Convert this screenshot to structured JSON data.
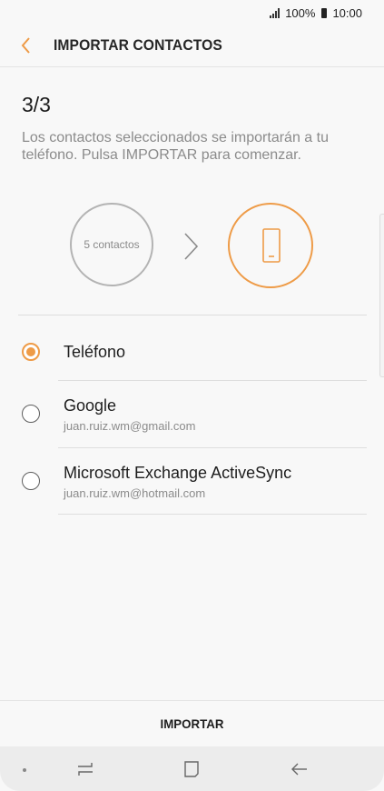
{
  "status_bar": {
    "battery": "100%",
    "time": "10:00"
  },
  "header": {
    "title": "IMPORTAR CONTACTOS"
  },
  "step": "3/3",
  "description": "Los contactos seleccionados se importarán a tu teléfono. Pulsa IMPORTAR para comenzar.",
  "source_circle": {
    "label": "5 contactos"
  },
  "options": [
    {
      "label": "Teléfono",
      "sub": "",
      "selected": true
    },
    {
      "label": "Google",
      "sub": "juan.ruiz.wm@gmail.com",
      "selected": false
    },
    {
      "label": "Microsoft Exchange ActiveSync",
      "sub": "juan.ruiz.wm@hotmail.com",
      "selected": false
    }
  ],
  "import_button": "IMPORTAR",
  "colors": {
    "accent": "#ee9b47",
    "background": "#f8f8f8"
  },
  "icons": {
    "back": "chevron-left-icon",
    "arrow": "chevron-right-icon",
    "target": "phone-icon",
    "recent": "recent-apps-icon",
    "home": "home-icon",
    "nav_back": "back-arrow-icon"
  }
}
